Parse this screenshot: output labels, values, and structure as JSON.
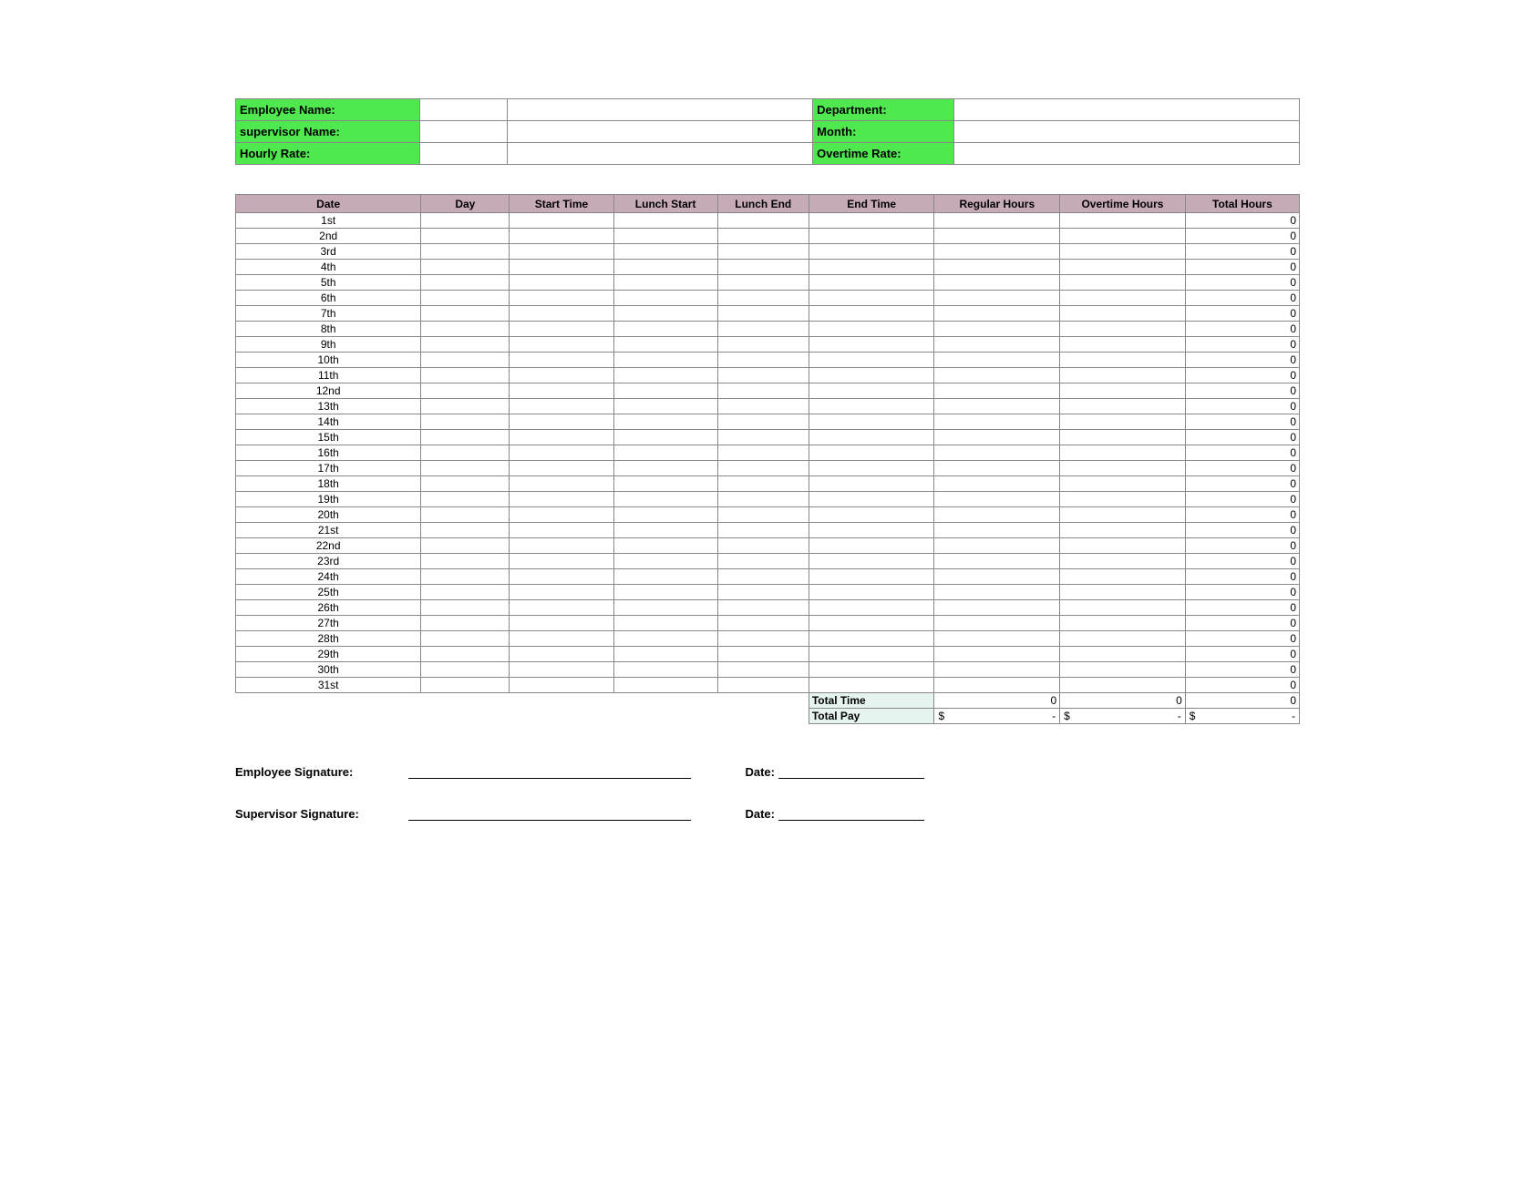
{
  "info": {
    "employee_name_label": "Employee Name:",
    "supervisor_name_label": "supervisor Name:",
    "hourly_rate_label": "Hourly Rate:",
    "department_label": "Department:",
    "month_label": "Month:",
    "overtime_rate_label": "Overtime Rate:",
    "employee_name": "",
    "supervisor_name": "",
    "hourly_rate": "",
    "department": "",
    "month": "",
    "overtime_rate": ""
  },
  "columns": {
    "date": "Date",
    "day": "Day",
    "start_time": "Start Time",
    "lunch_start": "Lunch Start",
    "lunch_end": "Lunch End",
    "end_time": "End Time",
    "regular_hours": "Regular Hours",
    "overtime_hours": "Overtime Hours",
    "total_hours": "Total Hours"
  },
  "rows": [
    {
      "date": "1st",
      "day": "",
      "start": "",
      "ls": "",
      "le": "",
      "end": "",
      "reg": "",
      "ot": "",
      "total": "0"
    },
    {
      "date": "2nd",
      "day": "",
      "start": "",
      "ls": "",
      "le": "",
      "end": "",
      "reg": "",
      "ot": "",
      "total": "0"
    },
    {
      "date": "3rd",
      "day": "",
      "start": "",
      "ls": "",
      "le": "",
      "end": "",
      "reg": "",
      "ot": "",
      "total": "0"
    },
    {
      "date": "4th",
      "day": "",
      "start": "",
      "ls": "",
      "le": "",
      "end": "",
      "reg": "",
      "ot": "",
      "total": "0"
    },
    {
      "date": "5th",
      "day": "",
      "start": "",
      "ls": "",
      "le": "",
      "end": "",
      "reg": "",
      "ot": "",
      "total": "0"
    },
    {
      "date": "6th",
      "day": "",
      "start": "",
      "ls": "",
      "le": "",
      "end": "",
      "reg": "",
      "ot": "",
      "total": "0"
    },
    {
      "date": "7th",
      "day": "",
      "start": "",
      "ls": "",
      "le": "",
      "end": "",
      "reg": "",
      "ot": "",
      "total": "0"
    },
    {
      "date": "8th",
      "day": "",
      "start": "",
      "ls": "",
      "le": "",
      "end": "",
      "reg": "",
      "ot": "",
      "total": "0"
    },
    {
      "date": "9th",
      "day": "",
      "start": "",
      "ls": "",
      "le": "",
      "end": "",
      "reg": "",
      "ot": "",
      "total": "0"
    },
    {
      "date": "10th",
      "day": "",
      "start": "",
      "ls": "",
      "le": "",
      "end": "",
      "reg": "",
      "ot": "",
      "total": "0"
    },
    {
      "date": "11th",
      "day": "",
      "start": "",
      "ls": "",
      "le": "",
      "end": "",
      "reg": "",
      "ot": "",
      "total": "0"
    },
    {
      "date": "12nd",
      "day": "",
      "start": "",
      "ls": "",
      "le": "",
      "end": "",
      "reg": "",
      "ot": "",
      "total": "0"
    },
    {
      "date": "13th",
      "day": "",
      "start": "",
      "ls": "",
      "le": "",
      "end": "",
      "reg": "",
      "ot": "",
      "total": "0"
    },
    {
      "date": "14th",
      "day": "",
      "start": "",
      "ls": "",
      "le": "",
      "end": "",
      "reg": "",
      "ot": "",
      "total": "0"
    },
    {
      "date": "15th",
      "day": "",
      "start": "",
      "ls": "",
      "le": "",
      "end": "",
      "reg": "",
      "ot": "",
      "total": "0"
    },
    {
      "date": "16th",
      "day": "",
      "start": "",
      "ls": "",
      "le": "",
      "end": "",
      "reg": "",
      "ot": "",
      "total": "0"
    },
    {
      "date": "17th",
      "day": "",
      "start": "",
      "ls": "",
      "le": "",
      "end": "",
      "reg": "",
      "ot": "",
      "total": "0"
    },
    {
      "date": "18th",
      "day": "",
      "start": "",
      "ls": "",
      "le": "",
      "end": "",
      "reg": "",
      "ot": "",
      "total": "0"
    },
    {
      "date": "19th",
      "day": "",
      "start": "",
      "ls": "",
      "le": "",
      "end": "",
      "reg": "",
      "ot": "",
      "total": "0"
    },
    {
      "date": "20th",
      "day": "",
      "start": "",
      "ls": "",
      "le": "",
      "end": "",
      "reg": "",
      "ot": "",
      "total": "0"
    },
    {
      "date": "21st",
      "day": "",
      "start": "",
      "ls": "",
      "le": "",
      "end": "",
      "reg": "",
      "ot": "",
      "total": "0"
    },
    {
      "date": "22nd",
      "day": "",
      "start": "",
      "ls": "",
      "le": "",
      "end": "",
      "reg": "",
      "ot": "",
      "total": "0"
    },
    {
      "date": "23rd",
      "day": "",
      "start": "",
      "ls": "",
      "le": "",
      "end": "",
      "reg": "",
      "ot": "",
      "total": "0"
    },
    {
      "date": "24th",
      "day": "",
      "start": "",
      "ls": "",
      "le": "",
      "end": "",
      "reg": "",
      "ot": "",
      "total": "0"
    },
    {
      "date": "25th",
      "day": "",
      "start": "",
      "ls": "",
      "le": "",
      "end": "",
      "reg": "",
      "ot": "",
      "total": "0"
    },
    {
      "date": "26th",
      "day": "",
      "start": "",
      "ls": "",
      "le": "",
      "end": "",
      "reg": "",
      "ot": "",
      "total": "0"
    },
    {
      "date": "27th",
      "day": "",
      "start": "",
      "ls": "",
      "le": "",
      "end": "",
      "reg": "",
      "ot": "",
      "total": "0"
    },
    {
      "date": "28th",
      "day": "",
      "start": "",
      "ls": "",
      "le": "",
      "end": "",
      "reg": "",
      "ot": "",
      "total": "0"
    },
    {
      "date": "29th",
      "day": "",
      "start": "",
      "ls": "",
      "le": "",
      "end": "",
      "reg": "",
      "ot": "",
      "total": "0"
    },
    {
      "date": "30th",
      "day": "",
      "start": "",
      "ls": "",
      "le": "",
      "end": "",
      "reg": "",
      "ot": "",
      "total": "0"
    },
    {
      "date": "31st",
      "day": "",
      "start": "",
      "ls": "",
      "le": "",
      "end": "",
      "reg": "",
      "ot": "",
      "total": "0"
    }
  ],
  "summary": {
    "total_time_label": "Total Time",
    "total_pay_label": "Total Pay",
    "total_reg": "0",
    "total_ot": "0",
    "total_all": "0",
    "pay_currency": "$",
    "pay_dash": "-"
  },
  "signatures": {
    "employee_label": "Employee Signature:",
    "supervisor_label": "Supervisor Signature:",
    "date_label": "Date:"
  }
}
